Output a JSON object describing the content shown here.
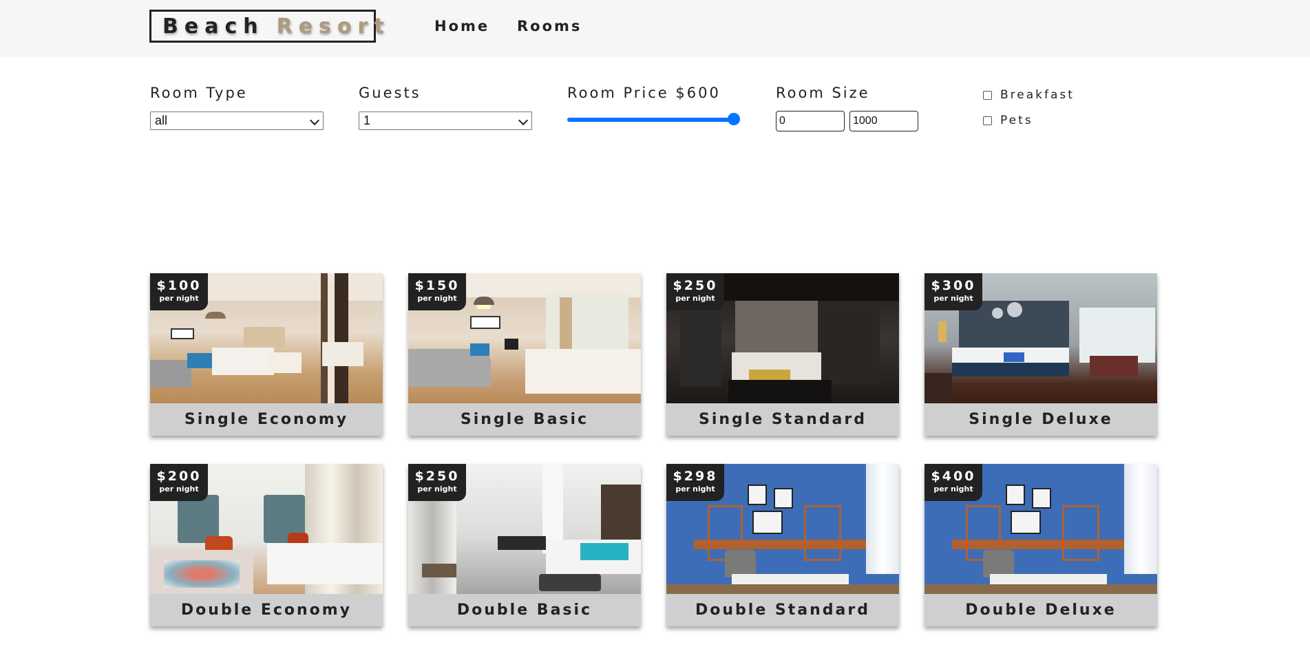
{
  "navbar": {
    "logo_word1": "Beach",
    "logo_word2": "Resort",
    "links": [
      "Home",
      "Rooms"
    ]
  },
  "filters": {
    "room_type_label": "Room Type",
    "room_type_value": "all",
    "guests_label": "Guests",
    "guests_value": "1",
    "price_label": "Room Price $600",
    "price_slider_fraction": 1.0,
    "size_label": "Room Size",
    "size_min": "0",
    "size_max": "1000",
    "breakfast_label": "Breakfast",
    "breakfast_checked": false,
    "pets_label": "Pets",
    "pets_checked": false
  },
  "rooms": [
    {
      "name": "Single Economy",
      "price": "$100",
      "per": "per night"
    },
    {
      "name": "Single Basic",
      "price": "$150",
      "per": "per night"
    },
    {
      "name": "Single Standard",
      "price": "$250",
      "per": "per night"
    },
    {
      "name": "Single Deluxe",
      "price": "$300",
      "per": "per night"
    },
    {
      "name": "Double Economy",
      "price": "$200",
      "per": "per night"
    },
    {
      "name": "Double Basic",
      "price": "$250",
      "per": "per night"
    },
    {
      "name": "Double Standard",
      "price": "$298",
      "per": "per night"
    },
    {
      "name": "Double Deluxe",
      "price": "$400",
      "per": "per night"
    }
  ],
  "colors": {
    "accent_slider": "#0075ff",
    "logo_resort": "#af9a7d",
    "badge_bg": "#222222",
    "card_footer": "#cfcfcf"
  }
}
